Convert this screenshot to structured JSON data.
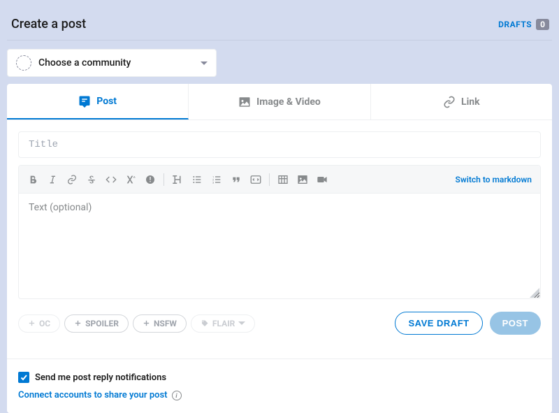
{
  "header": {
    "title": "Create a post",
    "drafts_label": "DRAFTS",
    "drafts_count": "0"
  },
  "community": {
    "placeholder": "Choose a community"
  },
  "tabs": {
    "post": "Post",
    "image_video": "Image & Video",
    "link": "Link"
  },
  "form": {
    "title_placeholder": "Title",
    "body_placeholder": "Text (optional)",
    "markdown_switch": "Switch to markdown"
  },
  "pills": {
    "oc": "OC",
    "spoiler": "SPOILER",
    "nsfw": "NSFW",
    "flair": "FLAIR"
  },
  "buttons": {
    "save_draft": "SAVE DRAFT",
    "post": "POST"
  },
  "footer": {
    "notify_label": "Send me post reply notifications",
    "connect_label": "Connect accounts to share your post"
  }
}
